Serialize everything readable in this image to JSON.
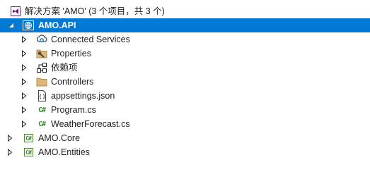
{
  "solution": {
    "label": "解决方案 'AMO' (3 个项目，共 3 个)",
    "icon": "vs-solution-icon"
  },
  "projects": [
    {
      "label": "AMO.API",
      "icon": "web-project-globe-icon",
      "expanded": true,
      "selected": true,
      "children": [
        {
          "label": "Connected Services",
          "icon": "connected-services-icon"
        },
        {
          "label": "Properties",
          "icon": "properties-folder-icon"
        },
        {
          "label": "依赖项",
          "icon": "dependencies-icon"
        },
        {
          "label": "Controllers",
          "icon": "folder-icon"
        },
        {
          "label": "appsettings.json",
          "icon": "json-file-icon"
        },
        {
          "label": "Program.cs",
          "icon": "csharp-file-icon",
          "badge": "C#"
        },
        {
          "label": "WeatherForecast.cs",
          "icon": "csharp-file-icon",
          "badge": "C#"
        }
      ]
    },
    {
      "label": "AMO.Core",
      "icon": "csharp-project-icon",
      "badge": "C#",
      "expanded": false
    },
    {
      "label": "AMO.Entities",
      "icon": "csharp-project-icon",
      "badge": "C#",
      "expanded": false
    }
  ],
  "colors": {
    "selection": "#0078d4",
    "vs_purple": "#68217a",
    "csharp_green": "#388a34",
    "folder": "#dcb67a"
  }
}
